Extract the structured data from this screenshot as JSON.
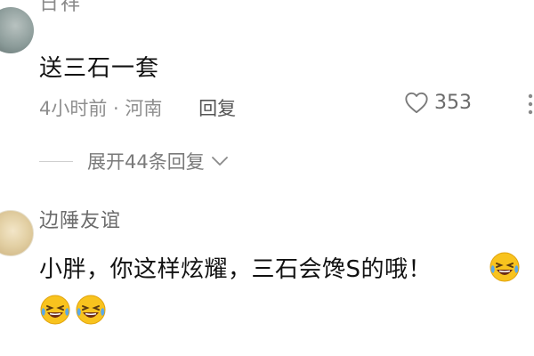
{
  "comment1": {
    "name_partial": "日祥",
    "text": "送三石一套",
    "time_location": "4小时前 · 河南",
    "reply_label": "回复",
    "like_count": "353",
    "expand_label": "展开44条回复"
  },
  "comment2": {
    "username": "边陲友谊",
    "text": "小胖，你这样炫耀，三石会馋S的哦！"
  },
  "icons": {
    "like": "heart-outline-icon",
    "more": "more-vertical-icon",
    "expand": "chevron-down-icon",
    "emoji": "laughing-crying-emoji"
  },
  "colors": {
    "text_primary": "#111111",
    "text_secondary": "#8e8e8e",
    "emoji_yellow": "#f8c31e",
    "emoji_blue": "#5aa9ea"
  }
}
